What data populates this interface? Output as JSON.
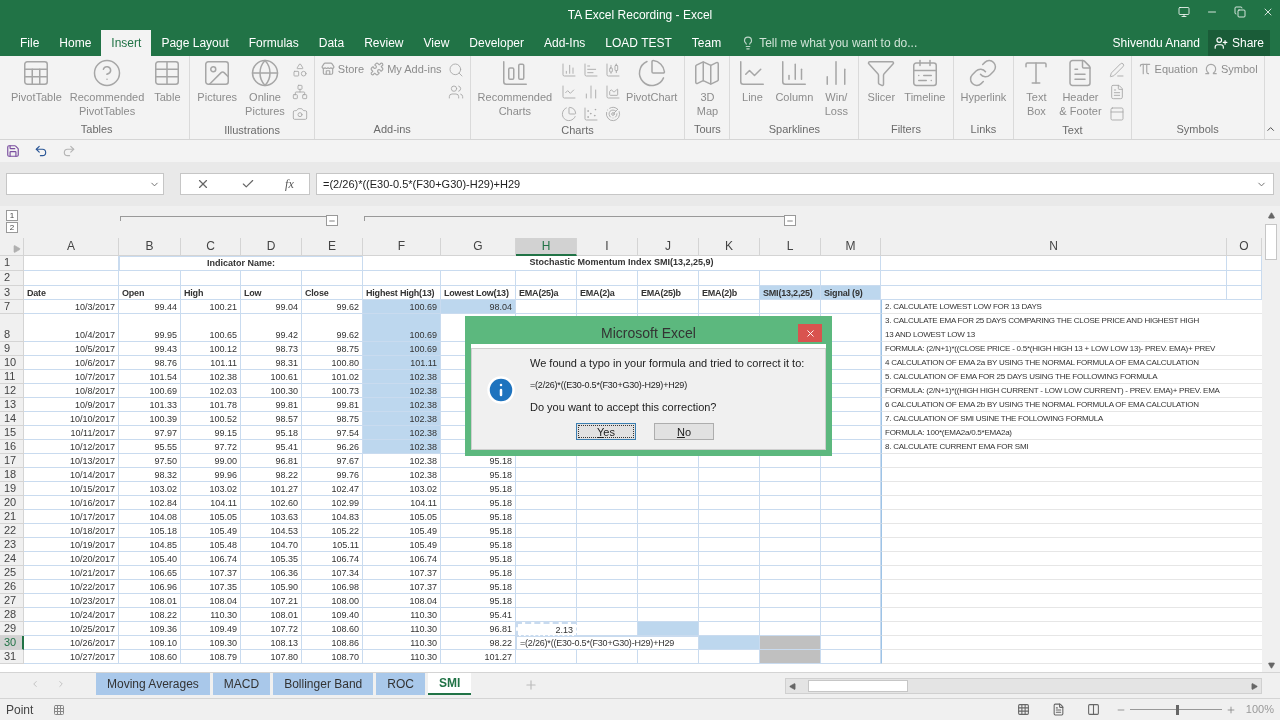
{
  "window": {
    "title": "TA Excel Recording - Excel"
  },
  "tabs": [
    {
      "label": "File",
      "selected": false
    },
    {
      "label": "Home",
      "selected": false
    },
    {
      "label": "Insert",
      "selected": true
    },
    {
      "label": "Page Layout",
      "selected": false
    },
    {
      "label": "Formulas",
      "selected": false
    },
    {
      "label": "Data",
      "selected": false
    },
    {
      "label": "Review",
      "selected": false
    },
    {
      "label": "View",
      "selected": false
    },
    {
      "label": "Developer",
      "selected": false
    },
    {
      "label": "Add-Ins",
      "selected": false
    },
    {
      "label": "LOAD TEST",
      "selected": false
    },
    {
      "label": "Team",
      "selected": false
    }
  ],
  "tell_me": {
    "placeholder": "Tell me what you want to do..."
  },
  "user": "Shivendu Anand",
  "share": "Share",
  "ribbon": {
    "disabled": true,
    "groups": [
      {
        "label": "Tables",
        "items": [
          {
            "kind": "large",
            "label": "PivotTable"
          },
          {
            "kind": "large",
            "label": "Recommended\nPivotTables"
          },
          {
            "kind": "large",
            "label": "Table"
          }
        ]
      },
      {
        "label": "Illustrations",
        "items": [
          {
            "kind": "large",
            "label": "Pictures"
          },
          {
            "kind": "large",
            "label": "Online\nPictures"
          },
          {
            "kind": "icons"
          }
        ]
      },
      {
        "label": "Add-ins",
        "items": [
          {
            "kind": "small",
            "label": "Store"
          },
          {
            "kind": "small",
            "label": "My Add-ins"
          },
          {
            "kind": "icons"
          }
        ]
      },
      {
        "label": "Charts",
        "items": [
          {
            "kind": "large",
            "label": "Recommended\nCharts"
          },
          {
            "kind": "grid"
          },
          {
            "kind": "large",
            "label": "PivotChart"
          }
        ]
      },
      {
        "label": "Tours",
        "items": [
          {
            "kind": "large",
            "label": "3D\nMap"
          }
        ]
      },
      {
        "label": "Sparklines",
        "items": [
          {
            "kind": "large",
            "label": "Line"
          },
          {
            "kind": "large",
            "label": "Column"
          },
          {
            "kind": "large",
            "label": "Win/\nLoss"
          }
        ]
      },
      {
        "label": "Filters",
        "items": [
          {
            "kind": "large",
            "label": "Slicer"
          },
          {
            "kind": "large",
            "label": "Timeline"
          }
        ]
      },
      {
        "label": "Links",
        "items": [
          {
            "kind": "large",
            "label": "Hyperlink"
          }
        ]
      },
      {
        "label": "Text",
        "items": [
          {
            "kind": "large",
            "label": "Text\nBox"
          },
          {
            "kind": "large",
            "label": "Header\n& Footer"
          },
          {
            "kind": "icons"
          }
        ]
      },
      {
        "label": "Symbols",
        "items": [
          {
            "kind": "small",
            "label": "Equation"
          },
          {
            "kind": "small",
            "label": "Symbol"
          }
        ]
      }
    ]
  },
  "formula_bar": {
    "function_label": "fx",
    "formula": "=(2/26)*((E30-0.5*(F30+G30)-H29)+H29"
  },
  "outline_levels": [
    "1",
    "2"
  ],
  "columns": [
    {
      "label": "A",
      "selected": false
    },
    {
      "label": "B",
      "selected": false
    },
    {
      "label": "C",
      "selected": false
    },
    {
      "label": "D",
      "selected": false
    },
    {
      "label": "E",
      "selected": false
    },
    {
      "label": "F",
      "selected": false
    },
    {
      "label": "G",
      "selected": false
    },
    {
      "label": "H",
      "selected": true
    },
    {
      "label": "I",
      "selected": false
    },
    {
      "label": "J",
      "selected": false
    },
    {
      "label": "K",
      "selected": false
    },
    {
      "label": "L",
      "selected": false
    },
    {
      "label": "M",
      "selected": false
    },
    {
      "label": "N",
      "selected": false
    },
    {
      "label": "O",
      "selected": false
    }
  ],
  "title_row": {
    "number": "1",
    "left": "Indicator Name:",
    "right": "Stochastic Momentum Index SMI(13,2,25,9)"
  },
  "blank_row": {
    "number": "2"
  },
  "header_row": {
    "number": "3",
    "cells": [
      {
        "text": "Date",
        "shaded": false
      },
      {
        "text": "Open",
        "shaded": false
      },
      {
        "text": "High",
        "shaded": false
      },
      {
        "text": "Low",
        "shaded": false
      },
      {
        "text": "Close",
        "shaded": false
      },
      {
        "text": "Highest High(13)",
        "shaded": false
      },
      {
        "text": "Lowest Low(13)",
        "shaded": false
      },
      {
        "text": "EMA(25)a",
        "shaded": false
      },
      {
        "text": "EMA(2)a",
        "shaded": false
      },
      {
        "text": "EMA(25)b",
        "shaded": false
      },
      {
        "text": "EMA(2)b",
        "shaded": false
      },
      {
        "text": "SMI(13,2,25)",
        "shaded": true
      },
      {
        "text": "Signal (9)",
        "shaded": true
      }
    ]
  },
  "rows": [
    {
      "number": "7",
      "active": false,
      "tall": false,
      "range_selected": true,
      "cells": [
        "10/3/2017",
        "99.44",
        "100.21",
        "99.04",
        "99.62",
        "100.69",
        "98.04"
      ],
      "note": "2. CALCULATE LOWEST LOW FOR 13 DAYS"
    },
    {
      "number": "8",
      "active": false,
      "tall": true,
      "range_selected": true,
      "cells": [
        "10/4/2017",
        "99.95",
        "100.65",
        "99.42",
        "99.62",
        "100.69"
      ],
      "note": "3. CALCULATE EMA FOR 25 DAYS COMPARING THE CLOSE PRICE AND HIGHEST HIGH 13 AND LOWEST LOW 13"
    },
    {
      "number": "9",
      "active": false,
      "tall": false,
      "range_selected": true,
      "cells": [
        "10/5/2017",
        "99.43",
        "100.12",
        "98.73",
        "98.75",
        "100.69"
      ],
      "note": "FORMULA: (2/N+1)*((CLOSE PRICE - 0.5*(HIGH HIGH 13 + LOW LOW 13)- PREV. EMA)+ PREV"
    },
    {
      "number": "10",
      "active": false,
      "tall": false,
      "range_selected": true,
      "cells": [
        "10/6/2017",
        "98.76",
        "101.11",
        "98.31",
        "100.80",
        "101.11"
      ],
      "note": "4 CALCULATION OF EMA 2a BY USING THE NORMAL FORMULA OF EMA CALCULATION"
    },
    {
      "number": "11",
      "active": false,
      "tall": false,
      "range_selected": true,
      "cells": [
        "10/7/2017",
        "101.54",
        "102.38",
        "100.61",
        "101.02",
        "102.38"
      ],
      "note": "5. CALCULATION OF EMA FOR 25 DAYS USING THE FOLLOWING FORMULA"
    },
    {
      "number": "12",
      "active": false,
      "tall": false,
      "range_selected": true,
      "cells": [
        "10/8/2017",
        "100.69",
        "102.03",
        "100.30",
        "100.73",
        "102.38"
      ],
      "note": "FORMULA: (2/N+1)*((HIGH HIGH CURRENT - LOW LOW CURRENT) - PREV. EMA)+ PREV. EMA"
    },
    {
      "number": "13",
      "active": false,
      "tall": false,
      "range_selected": true,
      "cells": [
        "10/9/2017",
        "101.33",
        "101.78",
        "99.81",
        "99.81",
        "102.38"
      ],
      "note": "6 CALCULATION OF EMA 2b BY USING THE NORMAL FORMULA OF EMA CALCULATION"
    },
    {
      "number": "14",
      "active": false,
      "tall": false,
      "range_selected": true,
      "cells": [
        "10/10/2017",
        "100.39",
        "100.52",
        "98.57",
        "98.75",
        "102.38"
      ],
      "note": "7. CALCULATION OF SMI USINE THE FOLLOWING FORMULA"
    },
    {
      "number": "15",
      "active": false,
      "tall": false,
      "range_selected": true,
      "cells": [
        "10/11/2017",
        "97.97",
        "99.15",
        "95.18",
        "97.54",
        "102.38"
      ],
      "note": "FORMULA: 100*(EMA2a/0.5*EMA2a)"
    },
    {
      "number": "16",
      "active": false,
      "tall": false,
      "range_selected": true,
      "cells": [
        "10/12/2017",
        "95.55",
        "97.72",
        "95.41",
        "96.26",
        "102.38"
      ],
      "note": "8. CALCULATE CURRENT EMA FOR SMI"
    },
    {
      "number": "17",
      "active": false,
      "tall": false,
      "range_selected": false,
      "cells": [
        "10/13/2017",
        "97.50",
        "99.00",
        "96.81",
        "97.67",
        "102.38",
        "95.18"
      ]
    },
    {
      "number": "18",
      "active": false,
      "tall": false,
      "range_selected": false,
      "cells": [
        "10/14/2017",
        "98.32",
        "99.96",
        "98.22",
        "99.76",
        "102.38",
        "95.18"
      ]
    },
    {
      "number": "19",
      "active": false,
      "tall": false,
      "range_selected": false,
      "cells": [
        "10/15/2017",
        "103.02",
        "103.02",
        "101.27",
        "102.47",
        "103.02",
        "95.18"
      ]
    },
    {
      "number": "20",
      "active": false,
      "tall": false,
      "range_selected": false,
      "cells": [
        "10/16/2017",
        "102.84",
        "104.11",
        "102.60",
        "102.99",
        "104.11",
        "95.18"
      ]
    },
    {
      "number": "21",
      "active": false,
      "tall": false,
      "range_selected": false,
      "cells": [
        "10/17/2017",
        "104.08",
        "105.05",
        "103.63",
        "104.83",
        "105.05",
        "95.18"
      ]
    },
    {
      "number": "22",
      "active": false,
      "tall": false,
      "range_selected": false,
      "cells": [
        "10/18/2017",
        "105.18",
        "105.49",
        "104.53",
        "105.22",
        "105.49",
        "95.18"
      ]
    },
    {
      "number": "23",
      "active": false,
      "tall": false,
      "range_selected": false,
      "cells": [
        "10/19/2017",
        "104.85",
        "105.48",
        "104.70",
        "105.11",
        "105.49",
        "95.18"
      ]
    },
    {
      "number": "24",
      "active": false,
      "tall": false,
      "range_selected": false,
      "cells": [
        "10/20/2017",
        "105.40",
        "106.74",
        "105.35",
        "106.74",
        "106.74",
        "95.18"
      ]
    },
    {
      "number": "25",
      "active": false,
      "tall": false,
      "range_selected": false,
      "cells": [
        "10/21/2017",
        "106.65",
        "107.37",
        "106.36",
        "107.34",
        "107.37",
        "95.18"
      ]
    },
    {
      "number": "26",
      "active": false,
      "tall": false,
      "range_selected": false,
      "cells": [
        "10/22/2017",
        "106.96",
        "107.35",
        "105.90",
        "106.98",
        "107.37",
        "95.18"
      ]
    },
    {
      "number": "27",
      "active": false,
      "tall": false,
      "range_selected": false,
      "cells": [
        "10/23/2017",
        "108.01",
        "108.04",
        "107.21",
        "108.00",
        "108.04",
        "95.18"
      ]
    },
    {
      "number": "28",
      "active": false,
      "tall": false,
      "range_selected": false,
      "cells": [
        "10/24/2017",
        "108.22",
        "110.30",
        "108.01",
        "109.40",
        "110.30",
        "95.41"
      ]
    },
    {
      "number": "29",
      "active": false,
      "tall": false,
      "range_selected": false,
      "cells": [
        "10/25/2017",
        "109.36",
        "109.49",
        "107.72",
        "108.60",
        "110.30",
        "96.81"
      ],
      "right": [
        {
          "text": "2.13",
          "copied": true,
          "editing": false,
          "shaded": false
        },
        {
          "copied": false,
          "editing": false,
          "shaded": false
        },
        {
          "copied": false,
          "editing": false,
          "shaded": true,
          "color": "#bdd7ee"
        },
        {
          "copied": false,
          "editing": false,
          "shaded": false
        },
        {
          "copied": false,
          "editing": false,
          "shaded": false
        },
        {
          "copied": false,
          "editing": false,
          "shaded": false
        }
      ]
    },
    {
      "number": "30",
      "active": true,
      "tall": false,
      "range_selected": false,
      "cells": [
        "10/26/2017",
        "109.10",
        "109.30",
        "108.13",
        "108.86",
        "110.30",
        "98.22"
      ],
      "right": [
        {
          "text": "=(2/26)*((E30-0.5*(F30+G30)-H29)+H29",
          "copied": false,
          "editing": true,
          "shaded": false
        },
        {
          "copied": false,
          "editing": false,
          "shaded": true,
          "color": "#bdd7ee"
        },
        {
          "copied": false,
          "editing": false,
          "shaded": true,
          "color": "#c0c0c0"
        },
        {
          "copied": false,
          "editing": false,
          "shaded": false
        }
      ]
    },
    {
      "number": "31",
      "active": false,
      "tall": false,
      "range_selected": false,
      "cells": [
        "10/27/2017",
        "108.60",
        "108.79",
        "107.80",
        "108.70",
        "110.30",
        "101.27"
      ],
      "right": [
        {
          "copied": false,
          "editing": false,
          "shaded": false
        },
        {
          "copied": false,
          "editing": false,
          "shaded": false
        },
        {
          "copied": false,
          "editing": false,
          "shaded": false
        },
        {
          "copied": false,
          "editing": false,
          "shaded": false
        },
        {
          "copied": false,
          "editing": false,
          "shaded": true,
          "color": "#c0c0c0"
        },
        {
          "copied": false,
          "editing": false,
          "shaded": false
        }
      ]
    }
  ],
  "dialog": {
    "title": "Microsoft Excel",
    "message": "We found a typo in your formula and tried to correct it to:",
    "correction": "=(2/26)*((E30-0.5*(F30+G30)-H29)+H29)",
    "question": "Do you want to accept this correction?",
    "buttons": [
      {
        "label": "Yes",
        "focused": true
      },
      {
        "label": "No",
        "focused": false
      }
    ]
  },
  "sheet_tabs": [
    {
      "label": "Moving Averages",
      "selected": false
    },
    {
      "label": "MACD",
      "selected": false
    },
    {
      "label": "Bollinger Band",
      "selected": false
    },
    {
      "label": "ROC",
      "selected": false
    },
    {
      "label": "SMI",
      "selected": true
    }
  ],
  "status_bar": {
    "mode": "Point",
    "zoom": {
      "level": 0.5,
      "reading": "100%"
    }
  }
}
